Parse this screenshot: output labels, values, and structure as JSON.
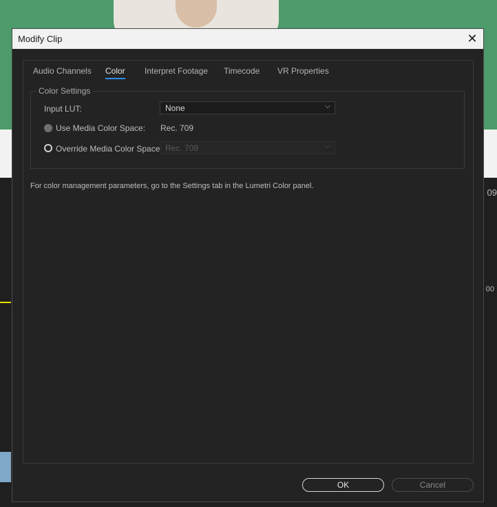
{
  "background": {
    "timecode": "09",
    "timecode2": "00"
  },
  "dialog": {
    "title": "Modify Clip",
    "close_glyph": "✕",
    "tabs": [
      {
        "label": "Audio Channels",
        "active": false
      },
      {
        "label": "Color",
        "active": true
      },
      {
        "label": "Interpret Footage",
        "active": false
      },
      {
        "label": "Timecode",
        "active": false
      },
      {
        "label": "VR Properties",
        "active": false
      }
    ],
    "color_settings": {
      "legend": "Color Settings",
      "input_lut_label": "Input LUT:",
      "input_lut_value": "None",
      "use_media_label": "Use Media Color Space:",
      "use_media_value": "Rec. 709",
      "override_label": "Override Media Color Space:",
      "override_value": "Rec. 709"
    },
    "note": "For color management parameters, go to the Settings tab in the Lumetri Color panel.",
    "ok_label": "OK",
    "cancel_label": "Cancel",
    "accent_color": "#2d8ceb"
  }
}
